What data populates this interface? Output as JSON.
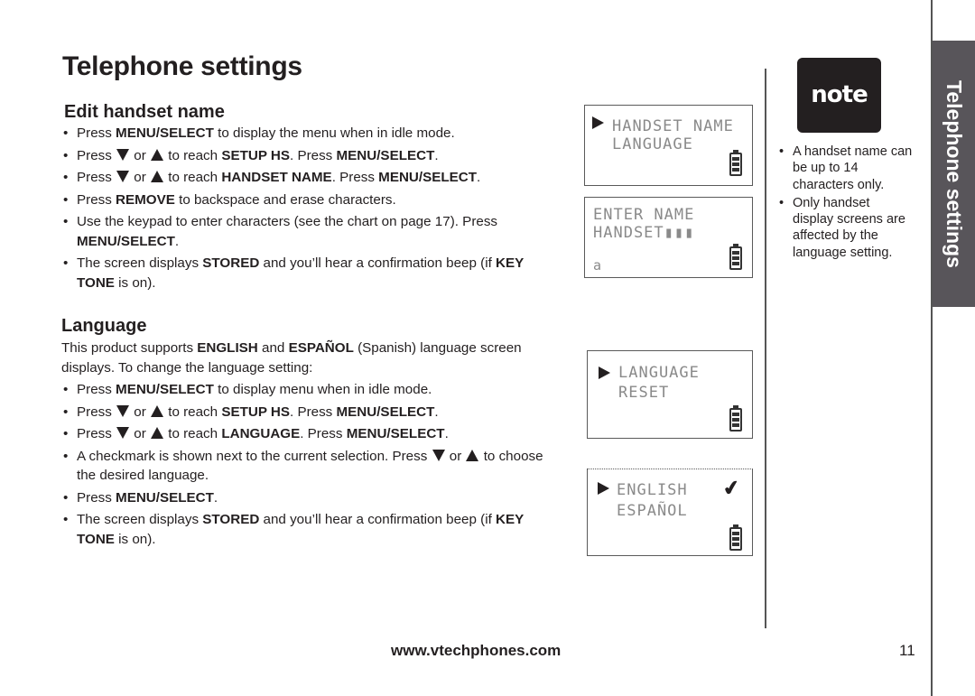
{
  "page_title": "Telephone settings",
  "sections": {
    "edit_handset": {
      "heading": "Edit handset name",
      "bullets": [
        [
          {
            "t": "Press "
          },
          {
            "b": "MENU/SELECT"
          },
          {
            "t": " to display the menu when in idle mode."
          }
        ],
        [
          {
            "t": "Press "
          },
          {
            "icon": "down"
          },
          {
            "t": " or "
          },
          {
            "icon": "up"
          },
          {
            "t": " to reach "
          },
          {
            "b": "SETUP HS"
          },
          {
            "t": ". Press "
          },
          {
            "b": "MENU/SELECT"
          },
          {
            "t": "."
          }
        ],
        [
          {
            "t": "Press "
          },
          {
            "icon": "down"
          },
          {
            "t": " or "
          },
          {
            "icon": "up"
          },
          {
            "t": " to reach "
          },
          {
            "b": "HANDSET NAME"
          },
          {
            "t": ". Press "
          },
          {
            "b": "MENU/SELECT"
          },
          {
            "t": "."
          }
        ],
        [
          {
            "t": "Press "
          },
          {
            "b": "REMOVE"
          },
          {
            "t": " to backspace and erase characters."
          }
        ],
        [
          {
            "t": "Use the keypad to enter characters (see the chart on page 17). Press "
          },
          {
            "b": "MENU/SELECT"
          },
          {
            "t": "."
          }
        ],
        [
          {
            "t": "The screen displays "
          },
          {
            "b": "STORED"
          },
          {
            "t": " and you’ll hear a confirmation beep (if "
          },
          {
            "b": "KEY TONE"
          },
          {
            "t": " is on)."
          }
        ]
      ]
    },
    "language": {
      "heading": "Language",
      "intro": [
        {
          "t": "This product supports "
        },
        {
          "b": "ENGLISH"
        },
        {
          "t": " and "
        },
        {
          "b": "ESPAÑOL"
        },
        {
          "t": " (Spanish) language screen displays. To change the language setting:"
        }
      ],
      "bullets": [
        [
          {
            "t": "Press "
          },
          {
            "b": "MENU/SELECT"
          },
          {
            "t": " to display menu when in idle mode."
          }
        ],
        [
          {
            "t": "Press "
          },
          {
            "icon": "down"
          },
          {
            "t": " or "
          },
          {
            "icon": "up"
          },
          {
            "t": " to reach "
          },
          {
            "b": "SETUP HS"
          },
          {
            "t": ". Press "
          },
          {
            "b": "MENU/SELECT"
          },
          {
            "t": "."
          }
        ],
        [
          {
            "t": "Press "
          },
          {
            "icon": "down"
          },
          {
            "t": " or "
          },
          {
            "icon": "up"
          },
          {
            "t": " to reach "
          },
          {
            "b": "LANGUAGE"
          },
          {
            "t": ". Press "
          },
          {
            "b": "MENU/SELECT"
          },
          {
            "t": "."
          }
        ],
        [
          {
            "t": "A checkmark is shown next to the current selection. Press "
          },
          {
            "icon": "down"
          },
          {
            "t": " or "
          },
          {
            "icon": "up"
          },
          {
            "t": " to choose the desired language."
          }
        ],
        [
          {
            "t": "Press "
          },
          {
            "b": "MENU/SELECT"
          },
          {
            "t": "."
          }
        ],
        [
          {
            "t": "The screen displays "
          },
          {
            "b": "STORED"
          },
          {
            "t": " and you’ll hear a confirmation beep (if "
          },
          {
            "b": "KEY TONE"
          },
          {
            "t": " is on)."
          }
        ]
      ]
    }
  },
  "screens": [
    {
      "lines": [
        "HANDSET NAME",
        "LANGUAGE"
      ],
      "selected_line": 0
    },
    {
      "lines": [
        "ENTER NAME",
        "HANDSET▮▮▮"
      ],
      "input": "a"
    },
    {
      "lines": [
        "LANGUAGE",
        "RESET"
      ],
      "selected_line": 0
    },
    {
      "lines": [
        "ENGLISH",
        "ESPAÑOL"
      ],
      "selected_line": 0,
      "checked_line": 0
    }
  ],
  "note": {
    "badge": "note",
    "items": [
      "A handset name can be up to 14 characters only.",
      "Only handset display screens are affected by the language setting."
    ]
  },
  "side_tab": "Telephone settings",
  "footer": {
    "url": "www.vtechphones.com",
    "page": "11"
  }
}
